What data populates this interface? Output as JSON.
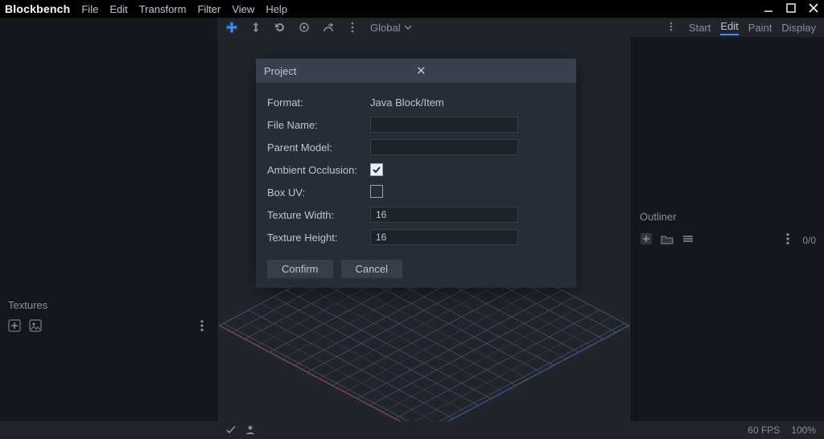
{
  "app": {
    "name": "Blockbench"
  },
  "menu": [
    "File",
    "Edit",
    "Transform",
    "Filter",
    "View",
    "Help"
  ],
  "toolbar": {
    "transform_space": "Global",
    "icons": [
      "move-tool-icon",
      "resize-tool-icon",
      "rotate-tool-icon",
      "pivot-tool-icon",
      "vertex-snap-icon",
      "more-icon"
    ]
  },
  "mode_tabs": {
    "items": [
      "Start",
      "Edit",
      "Paint",
      "Display"
    ],
    "active": "Edit"
  },
  "left_panel": {
    "title": "Textures"
  },
  "right_panel": {
    "title": "Outliner",
    "count": "0/0"
  },
  "status": {
    "fps": "60 FPS",
    "zoom": "100%"
  },
  "dialog": {
    "title": "Project",
    "rows": {
      "format": {
        "label": "Format:",
        "value": "Java Block/Item"
      },
      "file_name": {
        "label": "File Name:",
        "value": ""
      },
      "parent_model": {
        "label": "Parent Model:",
        "value": ""
      },
      "ambient_occlusion": {
        "label": "Ambient Occlusion:",
        "checked": true
      },
      "box_uv": {
        "label": "Box UV:",
        "checked": false
      },
      "texture_width": {
        "label": "Texture Width:",
        "value": "16"
      },
      "texture_height": {
        "label": "Texture Height:",
        "value": "16"
      }
    },
    "confirm": "Confirm",
    "cancel": "Cancel"
  }
}
